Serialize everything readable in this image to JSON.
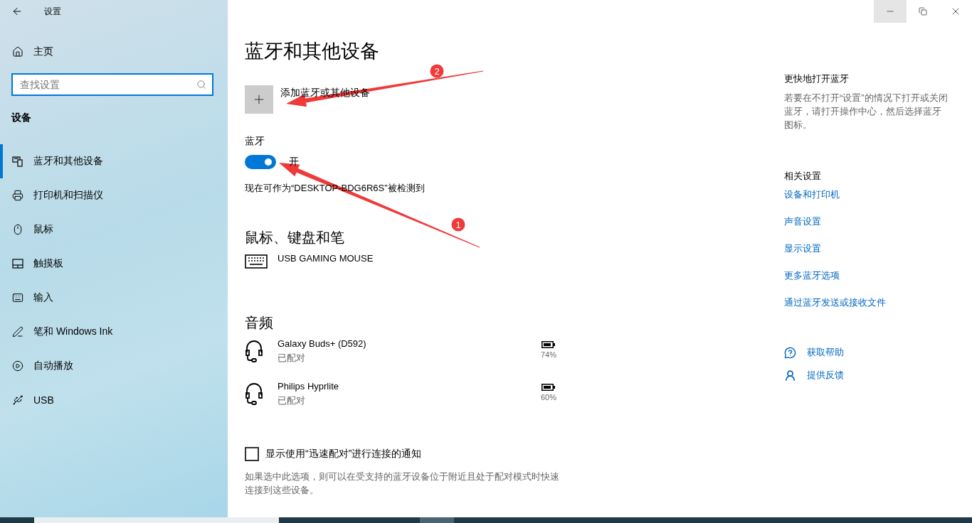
{
  "window": {
    "title": "设置",
    "controls": [
      {
        "kind": "minimize",
        "highlighted": true
      },
      {
        "kind": "restore",
        "highlighted": false
      },
      {
        "kind": "close",
        "highlighted": false
      }
    ]
  },
  "sidebar": {
    "home": "主页",
    "search": {
      "placeholder": "查找设置"
    },
    "section": "设备",
    "items": [
      {
        "label": "蓝牙和其他设备",
        "selected": true
      },
      {
        "label": "打印机和扫描仪",
        "selected": false
      },
      {
        "label": "鼠标",
        "selected": false
      },
      {
        "label": "触摸板",
        "selected": false
      },
      {
        "label": "输入",
        "selected": false
      },
      {
        "label": "笔和 Windows Ink",
        "selected": false
      },
      {
        "label": "自动播放",
        "selected": false
      },
      {
        "label": "USB",
        "selected": false
      }
    ]
  },
  "main": {
    "title": "蓝牙和其他设备",
    "add_device": "添加蓝牙或其他设备",
    "bluetooth": {
      "label": "蓝牙",
      "on": true,
      "state_text": "开",
      "discoverable": "现在可作为“DESKTOP-BDG6R6S”被检测到"
    },
    "groups": [
      {
        "title": "鼠标、键盘和笔",
        "devices": [
          {
            "kind": "keyboard",
            "name": "USB GAMING MOUSE"
          }
        ]
      },
      {
        "title": "音频",
        "devices": [
          {
            "kind": "headset",
            "name": "Galaxy Buds+ (D592)",
            "status": "已配对",
            "battery": "74%"
          },
          {
            "kind": "headset",
            "name": "Philips Hyprlite",
            "status": "已配对",
            "battery": "60%"
          }
        ]
      }
    ],
    "swift_pair": {
      "label": "显示使用“迅速配对”进行连接的通知",
      "checked": false,
      "description": "如果选中此选项，则可以在受支持的蓝牙设备位于附近且处于配对模式时快速连接到这些设备。"
    }
  },
  "aside": {
    "tip_title": "更快地打开蓝牙",
    "tip_text": "若要在不打开“设置”的情况下打开或关闭蓝牙，请打开操作中心，然后选择蓝牙图标。",
    "related_title": "相关设置",
    "links": [
      "设备和打印机",
      "声音设置",
      "显示设置",
      "更多蓝牙选项",
      "通过蓝牙发送或接收文件"
    ],
    "help": [
      {
        "kind": "help",
        "label": "获取帮助"
      },
      {
        "kind": "feedback",
        "label": "提供反馈"
      }
    ]
  },
  "annotations": [
    {
      "label": "2"
    },
    {
      "label": "1"
    }
  ]
}
